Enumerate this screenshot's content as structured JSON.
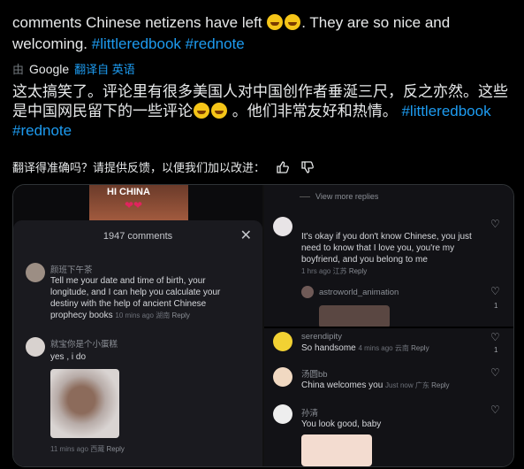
{
  "post": {
    "en_text_part1": "comments Chinese netizens have left",
    "en_text_part2": ". They are so nice and welcoming.",
    "hashtag_1": "#littleredbook",
    "hashtag_2": "#rednote",
    "translated_by_prefix": "由",
    "google_label": "Google",
    "translated_from_label": "翻译自 英语",
    "zh_text_part1": "这太搞笑了。评论里有很多美国人对中国创作者垂涎三尺，反之亦然。这些是中国网民留下的一些评论",
    "zh_text_part2": "。他们非常友好和热情。",
    "feedback_question": "翻译得准确吗？请提供反馈，以便我们加以改进："
  },
  "media": {
    "video_caption": "HI CHINA",
    "comments_title": "1947 comments",
    "left_comments": [
      {
        "name": "颜班下午茶",
        "text": "Tell me your date and time of birth, your longitude, and I can help you calculate your destiny with the help of ancient Chinese prophecy books",
        "time": "10 mins ago",
        "location": "湖南",
        "reply": "Reply"
      },
      {
        "name": "就宝你是个小蛋糕",
        "text": "yes , i do",
        "time": "11 mins ago",
        "location": "西藏",
        "reply": "Reply"
      }
    ],
    "view_more": "View more replies",
    "right_comments": [
      {
        "name": "",
        "text": "It's okay if you don't know Chinese, you just need to know that I love you, you're my boyfriend, and you belong to me",
        "time": "1 hrs ago",
        "location": "江苏",
        "reply": "Reply"
      },
      {
        "name": "astroworld_animation",
        "text": "",
        "count": "1"
      },
      {
        "name": "serendipity",
        "text": "So handsome",
        "time": "4 mins ago",
        "location": "云南",
        "reply": "Reply",
        "count": "1"
      },
      {
        "name": "汤圆bb",
        "text": "China welcomes you",
        "time": "Just now",
        "location": "广东",
        "reply": "Reply"
      },
      {
        "name": "孙清",
        "text": "You look good, baby",
        "time": "",
        "location": "",
        "reply": ""
      }
    ]
  },
  "colors": {
    "background": "#000000",
    "text": "#e7e9ea",
    "link": "#1d9bf0",
    "muted": "#71767b"
  }
}
